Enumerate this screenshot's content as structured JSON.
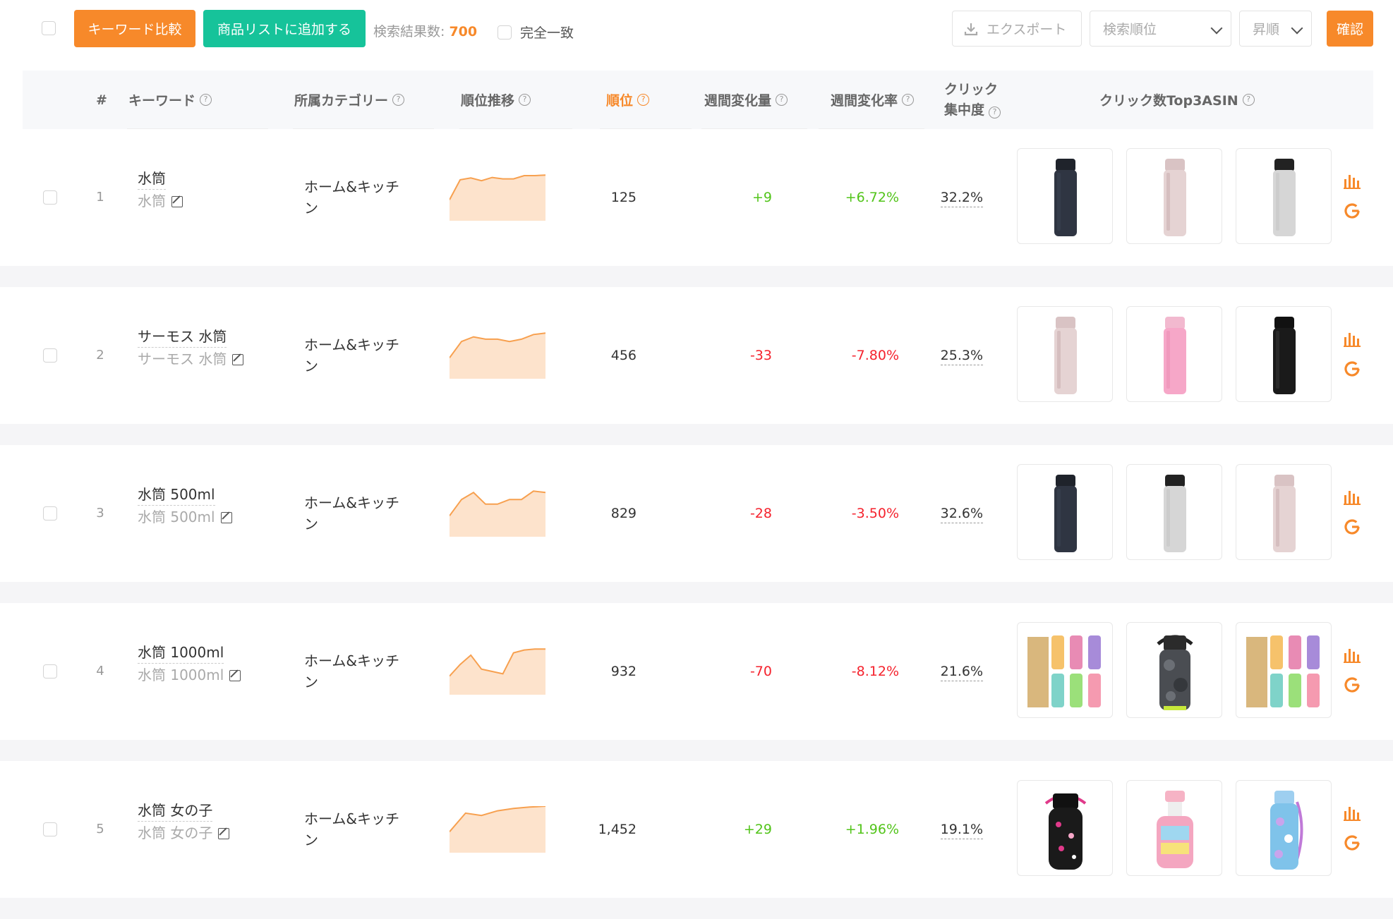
{
  "toolbar": {
    "compare_label": "キーワード比較",
    "add_list_label": "商品リストに追加する",
    "result_label": "検索結果数:",
    "result_count": "700",
    "exact_match_label": "完全一致",
    "export_label": "エクスポート",
    "sort_field": "検索順位",
    "sort_order": "昇順",
    "confirm_label": "確認"
  },
  "columns": {
    "index": "#",
    "keyword": "キーワード",
    "category": "所属カテゴリー",
    "rank_trend": "順位推移",
    "rank": "順位",
    "weekly_change": "週間変化量",
    "weekly_rate": "週間変化率",
    "click_concentration_1": "クリック",
    "click_concentration_2": "集中度",
    "top3": "クリック数Top3ASIN"
  },
  "colors": {
    "accent": "#f7892a",
    "green_button": "#16c39a",
    "positive": "#52c41a",
    "negative": "#f5222d"
  },
  "rows": [
    {
      "index": "1",
      "keyword": "水筒",
      "keyword_sub": "水筒",
      "category_line1": "ホーム&キッチ",
      "category_line2": "ン",
      "rank": "125",
      "change": "+9",
      "rate": "+6.72%",
      "direction": "up",
      "concentration": "32.2%",
      "trend": [
        0.55,
        0.12,
        0.08,
        0.14,
        0.07,
        0.1,
        0.1,
        0.03,
        0.03,
        0.02
      ],
      "products": [
        "navy-bottle",
        "pink-bottle",
        "white-bottle"
      ]
    },
    {
      "index": "2",
      "keyword": "サーモス 水筒",
      "keyword_sub": "サーモス 水筒",
      "category_line1": "ホーム&キッチ",
      "category_line2": "ン",
      "rank": "456",
      "change": "-33",
      "rate": "-7.80%",
      "direction": "down",
      "concentration": "25.3%",
      "trend": [
        0.55,
        0.2,
        0.1,
        0.15,
        0.15,
        0.2,
        0.15,
        0.05,
        0.02
      ],
      "products": [
        "pink-bottle",
        "light-pink-bottle",
        "black-bottle"
      ]
    },
    {
      "index": "3",
      "keyword": "水筒 500ml",
      "keyword_sub": "水筒 500ml",
      "category_line1": "ホーム&キッチ",
      "category_line2": "ン",
      "rank": "829",
      "change": "-28",
      "rate": "-3.50%",
      "direction": "down",
      "concentration": "32.6%",
      "trend": [
        0.55,
        0.2,
        0.05,
        0.3,
        0.3,
        0.2,
        0.2,
        0.02,
        0.05
      ],
      "products": [
        "navy-bottle",
        "white-bottle",
        "pink-bottle"
      ]
    },
    {
      "index": "4",
      "keyword": "水筒 1000ml",
      "keyword_sub": "水筒 1000ml",
      "category_line1": "ホーム&キッチ",
      "category_line2": "ン",
      "rank": "932",
      "change": "-70",
      "rate": "-8.12%",
      "direction": "down",
      "concentration": "21.6%",
      "trend": [
        0.6,
        0.35,
        0.15,
        0.45,
        0.5,
        0.55,
        0.1,
        0.04,
        0.02,
        0.02
      ],
      "products": [
        "colorful-bottles",
        "camo-bottle",
        "colorful-bottles"
      ]
    },
    {
      "index": "5",
      "keyword": "水筒 女の子",
      "keyword_sub": "水筒 女の子",
      "category_line1": "ホーム&キッチ",
      "category_line2": "ン",
      "rank": "1,452",
      "change": "+29",
      "rate": "+1.96%",
      "direction": "up",
      "concentration": "19.1%",
      "trend": [
        0.55,
        0.15,
        0.2,
        0.1,
        0.05,
        0.02,
        0.0
      ],
      "products": [
        "black-kids-bottle",
        "pink-kids-bottle",
        "blue-kids-bottle"
      ]
    }
  ]
}
